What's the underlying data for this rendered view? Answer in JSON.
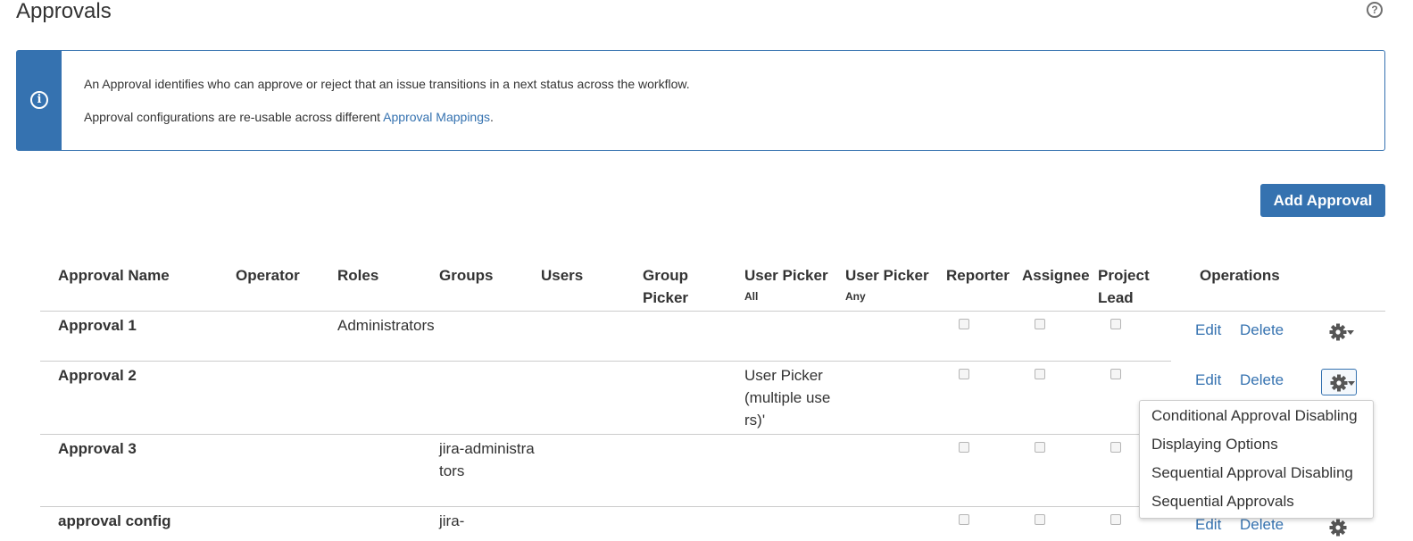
{
  "page": {
    "title": "Approvals",
    "help_icon": "?"
  },
  "info": {
    "icon": "i",
    "line1": "An Approval identifies who can approve or reject that an issue transitions in a next status across the workflow.",
    "line2_prefix": "Approval configurations are re-usable across different ",
    "line2_link": "Approval Mappings",
    "line2_suffix": "."
  },
  "add_button": "Add Approval",
  "table": {
    "headers": {
      "approval_name": "Approval Name",
      "operator": "Operator",
      "roles": "Roles",
      "groups": "Groups",
      "users": "Users",
      "group_picker_1": "Group",
      "group_picker_2": "Picker",
      "user_picker_all": "User Picker",
      "user_picker_all_sub": "All",
      "user_picker_any": "User Picker",
      "user_picker_any_sub": "Any",
      "reporter": "Reporter",
      "assignee": "Assignee",
      "project_lead_1": "Project",
      "project_lead_2": "Lead",
      "operations": "Operations"
    },
    "rows": [
      {
        "name": "Approval 1",
        "roles": "Administrators",
        "groups": "",
        "user_picker_all": "",
        "edit": "Edit",
        "delete": "Delete"
      },
      {
        "name": "Approval 2",
        "roles": "",
        "groups": "",
        "user_picker_all": "User Picker (multiple users)'",
        "edit": "Edit",
        "delete": "Delete"
      },
      {
        "name": "Approval 3",
        "roles": "",
        "groups": "jira-administrators",
        "user_picker_all": "",
        "edit": "Edit",
        "delete": "Delete"
      },
      {
        "name": "approval config",
        "roles": "",
        "groups": "jira-",
        "user_picker_all": "",
        "edit": "Edit",
        "delete": "Delete"
      }
    ]
  },
  "dropdown": {
    "items": [
      "Conditional Approval Disabling",
      "Displaying Options",
      "Sequential Approval Disabling",
      "Sequential Approvals"
    ]
  },
  "colors": {
    "accent": "#3572b0",
    "text": "#333333",
    "border": "#cccccc"
  },
  "icons": {
    "help": "help-icon",
    "info": "info-icon",
    "gear": "gear-icon",
    "caret": "caret-down-icon"
  }
}
